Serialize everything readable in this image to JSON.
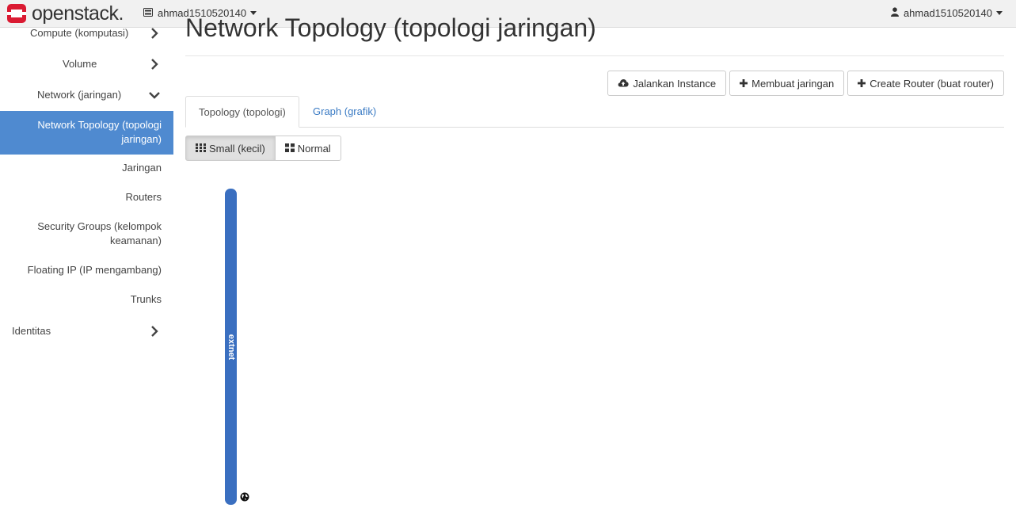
{
  "header": {
    "brand": "openstack.",
    "project": "ahmad1510520140",
    "user": "ahmad1510520140",
    "accent_color": "#da1a32"
  },
  "sidebar": {
    "items": [
      {
        "label": "Compute (komputasi)",
        "icon": "chevron-right-icon"
      },
      {
        "label": "Volume",
        "icon": "chevron-right-icon"
      },
      {
        "label": "Network (jaringan)",
        "icon": "chevron-down-icon"
      },
      {
        "label": "Network Topology (topologi jaringan)",
        "active": true
      },
      {
        "label": "Jaringan"
      },
      {
        "label": "Routers"
      },
      {
        "label": "Security Groups (kelompok keamanan)"
      },
      {
        "label": "Floating IP (IP mengambang)"
      },
      {
        "label": "Trunks"
      },
      {
        "label": "Identitas",
        "icon": "chevron-right-icon"
      }
    ],
    "active_color": "#4f8ad0"
  },
  "main": {
    "title": "Network Topology (topologi jaringan)",
    "actions": [
      {
        "label": "Jalankan Instance",
        "icon": "cloud-upload-icon"
      },
      {
        "label": "Membuat jaringan",
        "icon": "plus-icon"
      },
      {
        "label": "Create Router (buat router)",
        "icon": "plus-icon"
      }
    ],
    "tabs": [
      {
        "label": "Topology (topologi)",
        "active": true
      },
      {
        "label": "Graph (grafik)",
        "active": false
      }
    ],
    "size_options": [
      {
        "label": "Small (kecil)",
        "icon": "grid-small-icon",
        "active": true
      },
      {
        "label": "Normal",
        "icon": "grid-large-icon",
        "active": false
      }
    ],
    "topology": {
      "networks": [
        {
          "name": "extnet",
          "color": "#3a6fc0",
          "external": true
        }
      ]
    }
  }
}
